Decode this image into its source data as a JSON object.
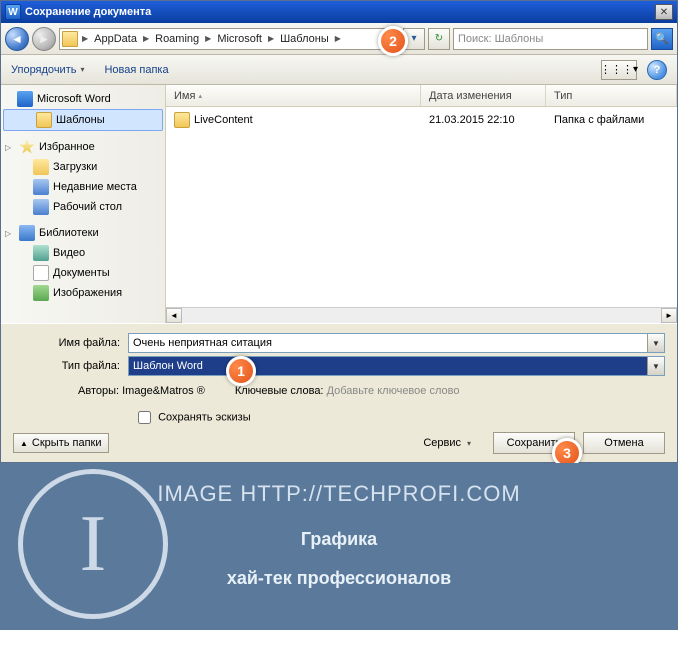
{
  "titlebar": {
    "title": "Сохранение документа",
    "close": "✕"
  },
  "nav": {
    "breadcrumb": [
      "AppData",
      "Roaming",
      "Microsoft",
      "Шаблоны"
    ],
    "search_placeholder": "Поиск: Шаблоны"
  },
  "toolbar": {
    "organize": "Упорядочить",
    "new_folder": "Новая папка",
    "view_glyph": "⋮⋮⋮",
    "help": "?"
  },
  "sidebar": {
    "word": "Microsoft Word",
    "templates": "Шаблоны",
    "favorites": "Избранное",
    "downloads": "Загрузки",
    "recent": "Недавние места",
    "desktop": "Рабочий стол",
    "libraries": "Библиотеки",
    "videos": "Видео",
    "documents": "Документы",
    "images": "Изображения"
  },
  "filelist": {
    "col_name": "Имя",
    "col_date": "Дата изменения",
    "col_type": "Тип",
    "rows": [
      {
        "name": "LiveContent",
        "date": "21.03.2015 22:10",
        "type": "Папка с файлами"
      }
    ]
  },
  "form": {
    "name_label": "Имя файла:",
    "name_value": "Очень неприятная ситация",
    "type_label": "Тип файла:",
    "type_value": "Шаблон Word",
    "authors_label": "Авторы:",
    "authors_value": "Image&Matros ®",
    "keywords_label": "Ключевые слова:",
    "keywords_hint": "Добавьте ключевое слово",
    "thumb_label": "Сохранять эскизы",
    "hide_folders": "Скрыть папки",
    "service": "Сервис",
    "save": "Сохранить",
    "cancel": "Отмена"
  },
  "markers": {
    "m1": "1",
    "m2": "2",
    "m3": "3"
  },
  "footer": {
    "url": "IMAGE HTTP://TECHPROFI.COM",
    "line1": "Графика",
    "line2": "хай-тек профессионалов",
    "letter": "I"
  }
}
